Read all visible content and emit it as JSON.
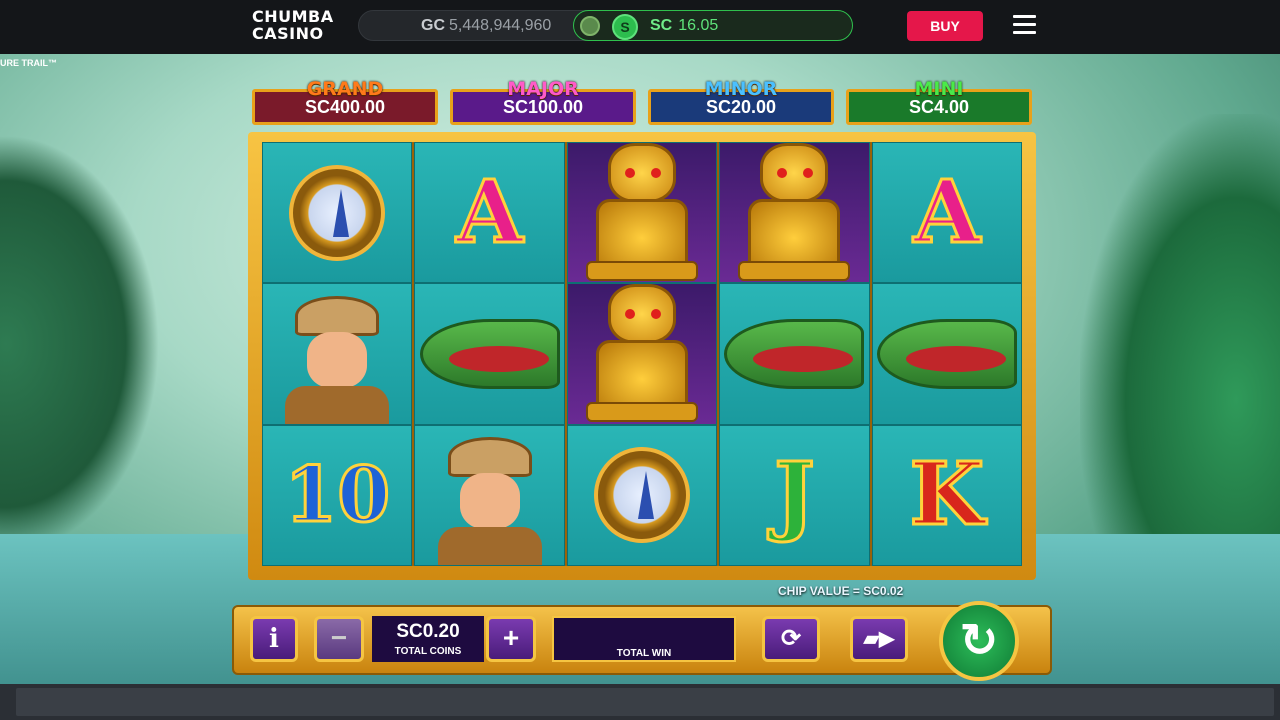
{
  "header": {
    "logo_line1": "CHUMBA",
    "logo_line2": "CASINO",
    "gc_label": "GC",
    "gc_value": "5,448,944,960",
    "sc_label": "SC",
    "sc_value": "16.05",
    "sc_coin_glyph": "S",
    "buy_label": "BUY"
  },
  "game": {
    "title_snippet": "URE TRAIL™",
    "jackpots": [
      {
        "label": "GRAND",
        "value": "SC400.00",
        "label_color": "#ff7a1a",
        "box_color": "#7a1a2a"
      },
      {
        "label": "MAJOR",
        "value": "SC100.00",
        "label_color": "#ff5ac8",
        "box_color": "#5a1a8a"
      },
      {
        "label": "MINOR",
        "value": "SC20.00",
        "label_color": "#4ac0ff",
        "box_color": "#1a3a7a"
      },
      {
        "label": "MINI",
        "value": "SC4.00",
        "label_color": "#4aea4a",
        "box_color": "#1a7a2a"
      }
    ],
    "reels": [
      [
        "compass",
        "explorer",
        "10"
      ],
      [
        "A",
        "crocodile",
        "explorer"
      ],
      [
        "monkey-idol",
        "monkey-idol",
        "compass"
      ],
      [
        "monkey-idol",
        "crocodile",
        "J"
      ],
      [
        "A",
        "crocodile",
        "K"
      ]
    ],
    "chip_value": "CHIP VALUE = SC0.02",
    "controls": {
      "info_glyph": "i",
      "minus_glyph": "−",
      "plus_glyph": "+",
      "bet_value": "SC0.20",
      "bet_label": "TOTAL COINS",
      "win_label": "TOTAL WIN",
      "autoplay_icon": "autoplay-icon",
      "turbo_icon": "turbo-icon",
      "spin_icon": "spin-icon"
    }
  }
}
